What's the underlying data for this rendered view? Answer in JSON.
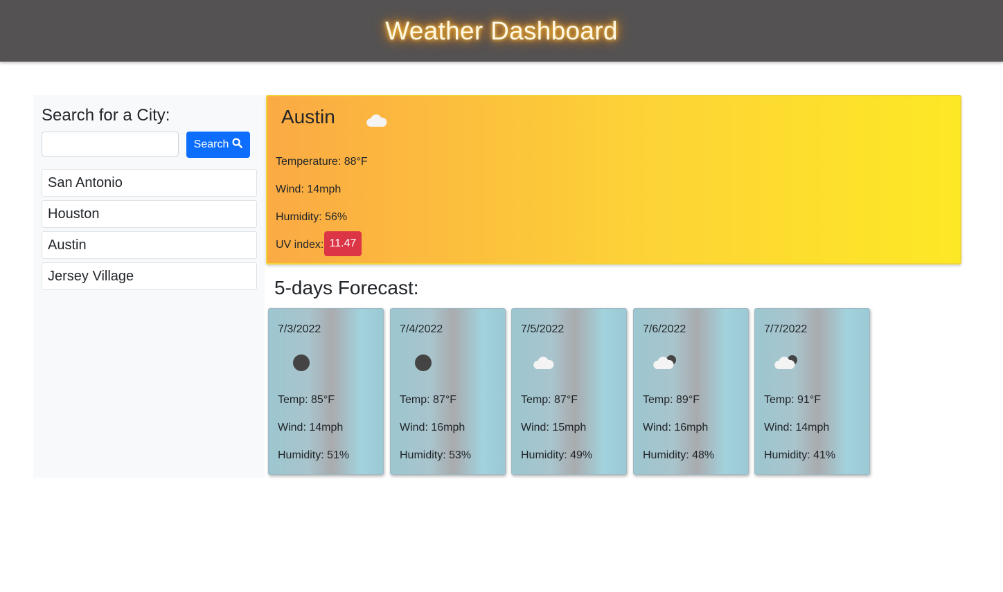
{
  "header": {
    "title": "Weather Dashboard"
  },
  "sidebar": {
    "heading": "Search for a City:",
    "search_input_value": "",
    "search_placeholder": "",
    "search_button_label": "Search",
    "history": [
      {
        "label": "San Antonio"
      },
      {
        "label": "Houston"
      },
      {
        "label": "Austin"
      },
      {
        "label": "Jersey Village"
      }
    ]
  },
  "current": {
    "city": "Austin",
    "icon": "cloud-icon",
    "temperature": "Temperature: 88°F",
    "wind": "Wind: 14mph",
    "humidity": "Humidity: 56%",
    "uv_label": "UV index:",
    "uv_value": "11.47",
    "uv_color": "#dc3545"
  },
  "forecast": {
    "title": "5-days Forecast:",
    "days": [
      {
        "date": "7/3/2022",
        "icon": "moon-icon",
        "temp": "Temp: 85°F",
        "wind": "Wind: 14mph",
        "humidity": "Humidity: 51%"
      },
      {
        "date": "7/4/2022",
        "icon": "moon-icon",
        "temp": "Temp: 87°F",
        "wind": "Wind: 16mph",
        "humidity": "Humidity: 53%"
      },
      {
        "date": "7/5/2022",
        "icon": "cloud-icon",
        "temp": "Temp: 87°F",
        "wind": "Wind: 15mph",
        "humidity": "Humidity: 49%"
      },
      {
        "date": "7/6/2022",
        "icon": "cloud-moon-icon",
        "temp": "Temp: 89°F",
        "wind": "Wind: 16mph",
        "humidity": "Humidity: 48%"
      },
      {
        "date": "7/7/2022",
        "icon": "cloud-moon-icon",
        "temp": "Temp: 91°F",
        "wind": "Wind: 14mph",
        "humidity": "Humidity: 41%"
      }
    ]
  },
  "colors": {
    "header_bg": "#545252",
    "button_blue": "#0d6efd",
    "uv_red": "#dc3545"
  }
}
